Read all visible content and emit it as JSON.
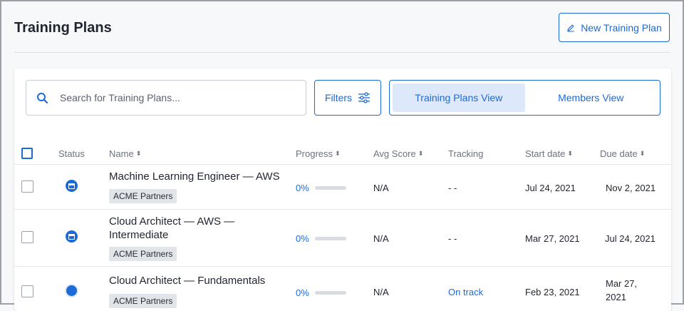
{
  "header": {
    "title": "Training Plans",
    "new_button_label": "New Training Plan"
  },
  "toolbar": {
    "search_placeholder": "Search for Training Plans...",
    "filters_label": "Filters",
    "views": [
      {
        "label": "Training Plans View",
        "active": true
      },
      {
        "label": "Members View",
        "active": false
      }
    ]
  },
  "table": {
    "columns": {
      "status": "Status",
      "name": "Name",
      "progress": "Progress",
      "avg_score": "Avg Score",
      "tracking": "Tracking",
      "start_date": "Start date",
      "due_date": "Due date"
    },
    "rows": [
      {
        "status_icon": "calendar-icon",
        "name": "Machine Learning Engineer — AWS",
        "tag": "ACME Partners",
        "progress_text": "0%",
        "progress_value": 0,
        "avg_score": "N/A",
        "tracking": "- -",
        "start_date": "Jul 24, 2021",
        "due_date": "Nov 2, 2021"
      },
      {
        "status_icon": "calendar-icon",
        "name": "Cloud Architect — AWS — Intermediate",
        "tag": "ACME Partners",
        "progress_text": "0%",
        "progress_value": 0,
        "avg_score": "N/A",
        "tracking": "- -",
        "start_date": "Mar 27, 2021",
        "due_date": "Jul 24, 2021"
      },
      {
        "status_icon": "dot-icon",
        "name": "Cloud Architect — Fundamentals",
        "tag": "ACME Partners",
        "progress_text": "0%",
        "progress_value": 0,
        "avg_score": "N/A",
        "tracking": "On track",
        "start_date": "Feb 23, 2021",
        "due_date": "Mar 27, 2021"
      }
    ]
  },
  "colors": {
    "accent": "#1a6ad8",
    "active_tab_bg": "#dde9fb",
    "tag_bg": "#e1e4e8"
  }
}
